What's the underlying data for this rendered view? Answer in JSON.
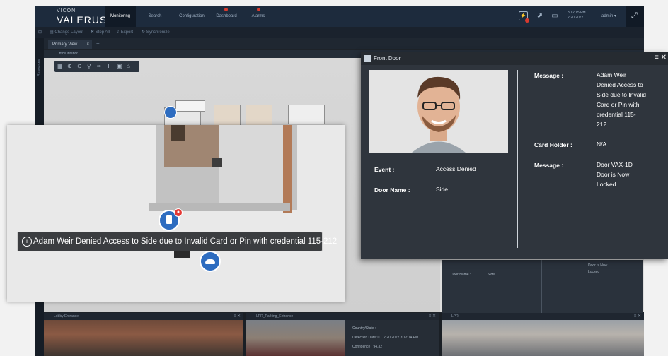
{
  "brand": {
    "top": "VICON",
    "name": "VALERUS"
  },
  "nav": {
    "tabs": [
      "Monitoring",
      "Search",
      "Configuration",
      "Dashboard",
      "Alarms"
    ]
  },
  "header": {
    "time": "3:12:15 PM",
    "date": "2/20/2022",
    "user": "admin ▾"
  },
  "toolbar": {
    "items": [
      "Change Layout",
      "Stop All",
      "Export",
      "Synchronize"
    ]
  },
  "left_rail": {
    "label": "Resources"
  },
  "view_tab": {
    "label": "Primary View"
  },
  "map_panel": {
    "title": "Office Interior"
  },
  "tooltip": {
    "text": "Adam Weir Denied Access to Side due to Invalid Card or Pin with credential 115-212"
  },
  "popup": {
    "title": "Front Door",
    "event_label": "Event :",
    "event_value": "Access Denied",
    "door_label": "Door Name :",
    "door_value": "Side",
    "message1_label": "Message :",
    "message1_lines": [
      "Adam Weir",
      "Denied Access to",
      "Side due to Invalid",
      "Card or Pin with",
      "credential 115-",
      "212"
    ],
    "cardholder_label": "Card Holder :",
    "cardholder_value": "N/A",
    "message2_label": "Message :",
    "message2_lines": [
      "Door VAX-1D",
      "Door is Now",
      "Locked"
    ]
  },
  "under_panel": {
    "door_label": "Door Name :",
    "door_value": "Side",
    "msg_a": "Door is Now",
    "msg_b": "Locked"
  },
  "bottom_panes": [
    {
      "title": "Lobby Entrance"
    },
    {
      "title": "LPR_Parking_Entrance"
    },
    {
      "title": "LPR"
    }
  ],
  "lpr_info": {
    "country_label": "Country/State :",
    "detection_label": "Detection Date/Ti...",
    "detection_value": "2/20/2022 3:12:14 PM",
    "confidence_label": "Confidence :",
    "confidence_value": "94.32"
  },
  "colors": {
    "accent": "#2d6cc0",
    "alert": "#e53935",
    "topbar": "#1d2b3d"
  }
}
